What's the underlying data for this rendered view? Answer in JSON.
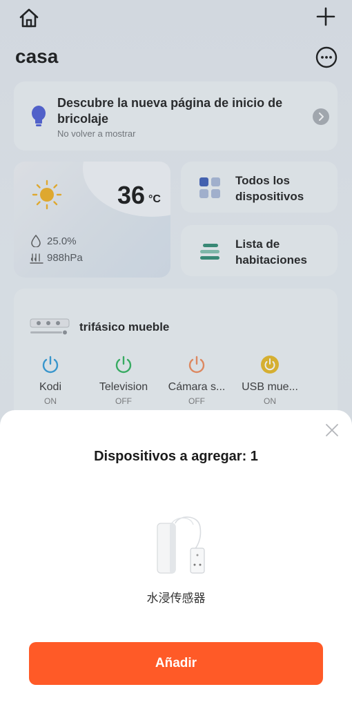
{
  "home": {
    "title": "casa"
  },
  "banner": {
    "title": "Descubre la nueva página de inicio de bricolaje",
    "subtitle": "No volver a mostrar"
  },
  "weather": {
    "temperature": "36",
    "unit": "°C",
    "humidity": "25.0%",
    "pressure": "988hPa"
  },
  "tiles": [
    {
      "label": "Todos los dispositivos"
    },
    {
      "label": "Lista de habitaciones"
    }
  ],
  "device": {
    "name": "trifásico mueble",
    "switches": [
      {
        "name": "Kodi",
        "state": "ON",
        "color": "#2e9ad8"
      },
      {
        "name": "Television",
        "state": "OFF",
        "color": "#2db35a"
      },
      {
        "name": "Cámara s...",
        "state": "OFF",
        "color": "#f08a58"
      },
      {
        "name": "USB mue...",
        "state": "ON",
        "color": "#e8b820"
      }
    ]
  },
  "sheet": {
    "title": "Dispositivos a agregar: 1",
    "product_name": "水浸传感器",
    "add_label": "Añadir"
  },
  "colors": {
    "accent": "#ff5a27",
    "bulb": "#4a5bd4",
    "tile_icon_blue": "#3a5bb6",
    "tile_icon_green": "#2d8a70"
  }
}
